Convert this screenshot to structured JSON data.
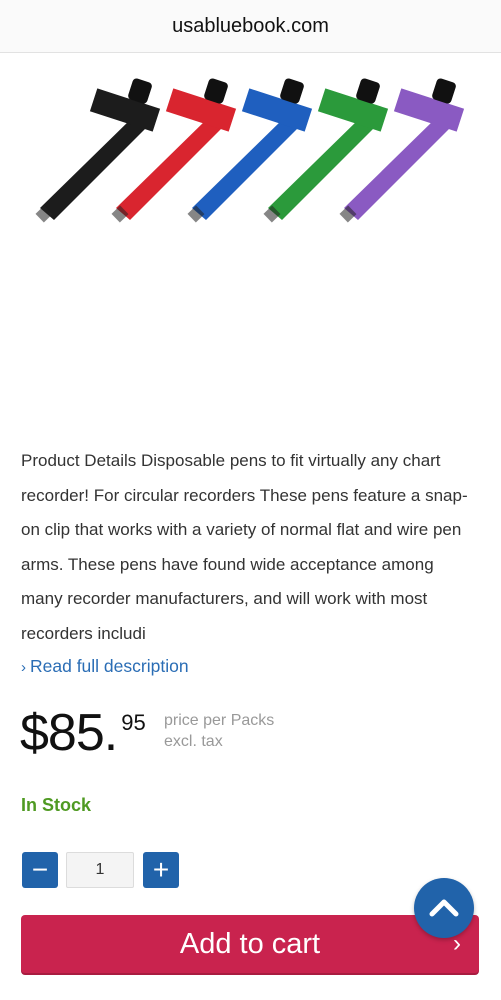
{
  "browser": {
    "url": "usabluebook.com"
  },
  "product": {
    "image_alt": "Disposable chart recorder pens in black, red, blue, green and purple",
    "pen_colors": [
      "#1c1c1c",
      "#d9252f",
      "#1f5fbf",
      "#2b9a3b",
      "#8a5ac2"
    ],
    "description": "Product Details Disposable pens to fit virtually any chart recorder! For circular recorders These pens feature a snap-on clip that works with a variety of normal flat and wire pen arms. These pens have found wide acceptance among many recorder manufacturers, and will work with most recorders includi",
    "read_more_label": "Read full description",
    "price_dollars": "$85.",
    "price_cents": "95",
    "price_unit": "price per Packs",
    "price_tax_note": "excl. tax",
    "stock_status": "In Stock",
    "stock_color": "#4f9a22"
  },
  "quantity": {
    "value": "1",
    "minus_label": "−",
    "plus_label": "+"
  },
  "cart": {
    "button_label": "Add to cart",
    "arrow": "›",
    "color": "#c9234e"
  },
  "scroll_top": {
    "icon": "chevron-up-icon",
    "color": "#2163aa"
  }
}
